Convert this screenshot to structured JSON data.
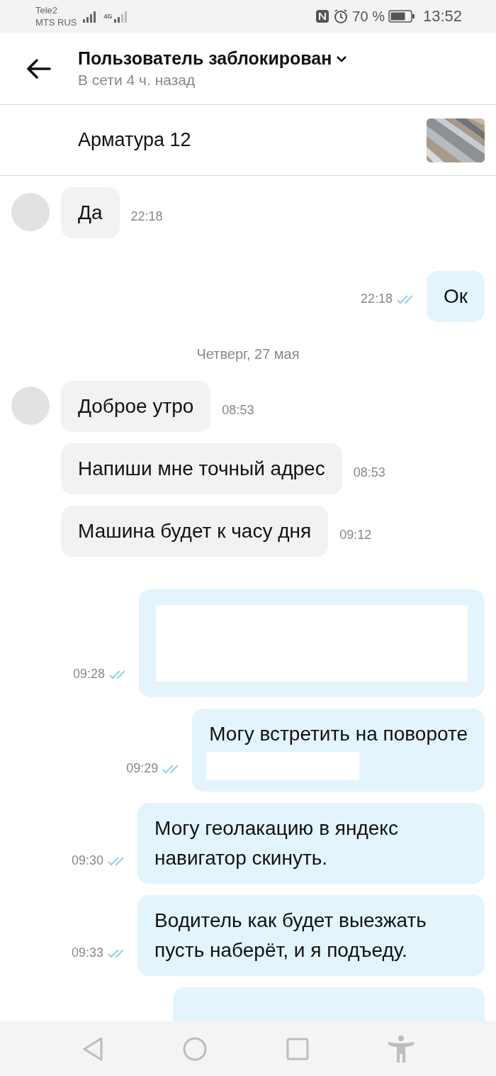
{
  "status_bar": {
    "carriers": [
      "Tele2",
      "MTS RUS"
    ],
    "network": "4G",
    "battery": "70 %",
    "time": "13:52"
  },
  "header": {
    "title": "Пользователь заблокирован",
    "subtitle": "В сети 4 ч. назад"
  },
  "listing": {
    "title": "Арматура 12"
  },
  "messages": [
    {
      "kind": "incoming",
      "text": "Да",
      "time": "22:18",
      "avatar": true
    },
    {
      "kind": "outgoing",
      "text": "Ок",
      "time": "22:18",
      "read": true
    },
    {
      "kind": "date",
      "text": "Четверг, 27 мая"
    },
    {
      "kind": "incoming",
      "text": "Доброе утро",
      "time": "08:53",
      "avatar": true
    },
    {
      "kind": "incoming",
      "text": "Напиши мне точный адрес",
      "time": "08:53",
      "avatar": false
    },
    {
      "kind": "incoming",
      "text": "Машина будет к часу дня",
      "time": "09:12",
      "avatar": false
    },
    {
      "kind": "outgoing",
      "redacted": true,
      "time": "09:28",
      "read": true
    },
    {
      "kind": "outgoing",
      "text": "Могу встретить на повороте",
      "redacted": true,
      "time": "09:29",
      "read": true
    },
    {
      "kind": "outgoing",
      "text": "Могу геолакацию в яндекс навигатор скинуть.",
      "time": "09:30",
      "read": true
    },
    {
      "kind": "outgoing",
      "text": "Водитель как будет выезжать пусть наберёт, и я подъеду.",
      "time": "09:33",
      "read": true
    },
    {
      "kind": "outgoing"
    }
  ]
}
